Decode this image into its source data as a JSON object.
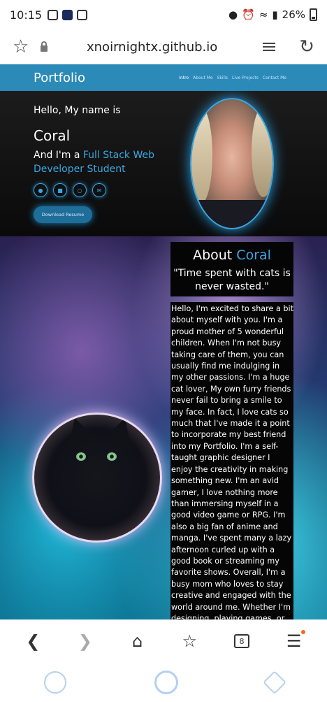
{
  "status": {
    "time": "10:15",
    "battery": "26%"
  },
  "browser": {
    "url": "xnoirnightx.github.io",
    "tab_count": "8"
  },
  "site": {
    "brand": "Portfolio",
    "nav": [
      "Intro",
      "About Me",
      "Skills",
      "Live Projects",
      "Contact Me"
    ],
    "hero": {
      "hello": "Hello, My name is",
      "name": "Coral",
      "role_prefix": "And I'm a ",
      "role_accent": "Full Stack Web Developer Student",
      "resume_button": "Download Resume"
    },
    "about": {
      "title_prefix": "About ",
      "title_accent": "Coral",
      "quote": "\"Time spent with cats is never wasted.\"",
      "body": "Hello, I'm excited to share a bit about myself with you. I'm a proud mother of 5 wonderful children. When I'm not busy taking care of them, you can usually find me indulging in my other passions. I'm a huge cat lover, My own furry friends never fail to bring a smile to my face. In fact, I love cats so much that I've made it a point to incorporate my best friend into my Portfolio. I'm a self-taught graphic designer I enjoy the creativity in making something new. I'm an avid gamer, I love nothing more than immersing myself in a good video game or RPG. I'm also a big fan of anime and manga. I've spent many a lazy afternoon curled up with a good book or streaming my favorite shows. Overall, I'm a busy mom who loves to stay creative and engaged with the world around me. Whether I'm designing, playing games, or cuddling with my cats reading a great book. I always try to approach everything I do with a sense of passion and"
    }
  },
  "colors": {
    "nav_bg": "#2b8ab8",
    "accent": "#3aa6e0",
    "menu_badge": "#f06b1e"
  }
}
